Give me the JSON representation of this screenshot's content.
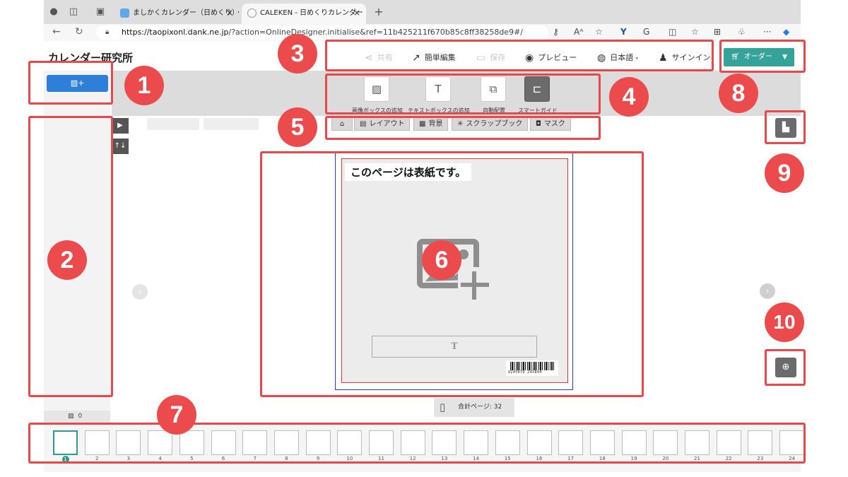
{
  "browser": {
    "tabs": [
      {
        "label": "ましかくカレンダー（日めくり）・",
        "close": "×"
      },
      {
        "label": "CALEKEN - 日めくりカレンダー",
        "close": "×"
      }
    ],
    "new_tab": "+",
    "url_host": "https://taopixonl.dank.ne.jp",
    "url_path": "/?action=OnlineDesigner.initialise&ref=11b425211f670b85c8ff38258de9#/",
    "icons": [
      "profile-icon",
      "workspaces-icon",
      "tab-actions-icon",
      "back-icon",
      "refresh-icon",
      "lock-icon",
      "key-icon",
      "read-aloud-icon",
      "favorite-icon",
      "split-icon",
      "favorites-icon",
      "collections-icon",
      "extensions-icon",
      "more-icon",
      "copilot-icon"
    ]
  },
  "app": {
    "logo": "カレンダー研究所",
    "header": {
      "share": "共有",
      "quick_edit": "簡単編集",
      "save": "保存",
      "preview": "プレビュー",
      "language": "日本語",
      "signin": "サインイン",
      "order": "オーダー"
    },
    "tools": [
      {
        "label": "画像ボックスの追加",
        "icon": "add-image-box-icon"
      },
      {
        "label": "テキストボックスの追加",
        "icon": "add-text-box-icon"
      },
      {
        "label": "自動配置",
        "icon": "auto-layout-icon"
      },
      {
        "label": "スマートガイド",
        "icon": "smart-guide-icon"
      }
    ],
    "panel_tabs": [
      "レイアウト",
      "背景",
      "スクラップブック",
      "マスク"
    ],
    "photo_count": "0",
    "cover_title": "このページは表紙です。",
    "text_placeholder": "T",
    "barcode_digits": "0245070 245894",
    "total_pages_label": "合計ページ: 32",
    "thumb_numbers": [
      "1",
      "2",
      "3",
      "4",
      "5",
      "6",
      "7",
      "8",
      "9",
      "10",
      "11",
      "12",
      "13",
      "14",
      "15",
      "16",
      "17",
      "18",
      "19",
      "20",
      "21",
      "22",
      "23",
      "24"
    ]
  },
  "annotations": [
    "1",
    "2",
    "3",
    "4",
    "5",
    "6",
    "7",
    "8",
    "9",
    "10"
  ],
  "colors": {
    "annotation": "#e8484b",
    "order": "#36a39a",
    "add_photo": "#2e7fd8"
  }
}
